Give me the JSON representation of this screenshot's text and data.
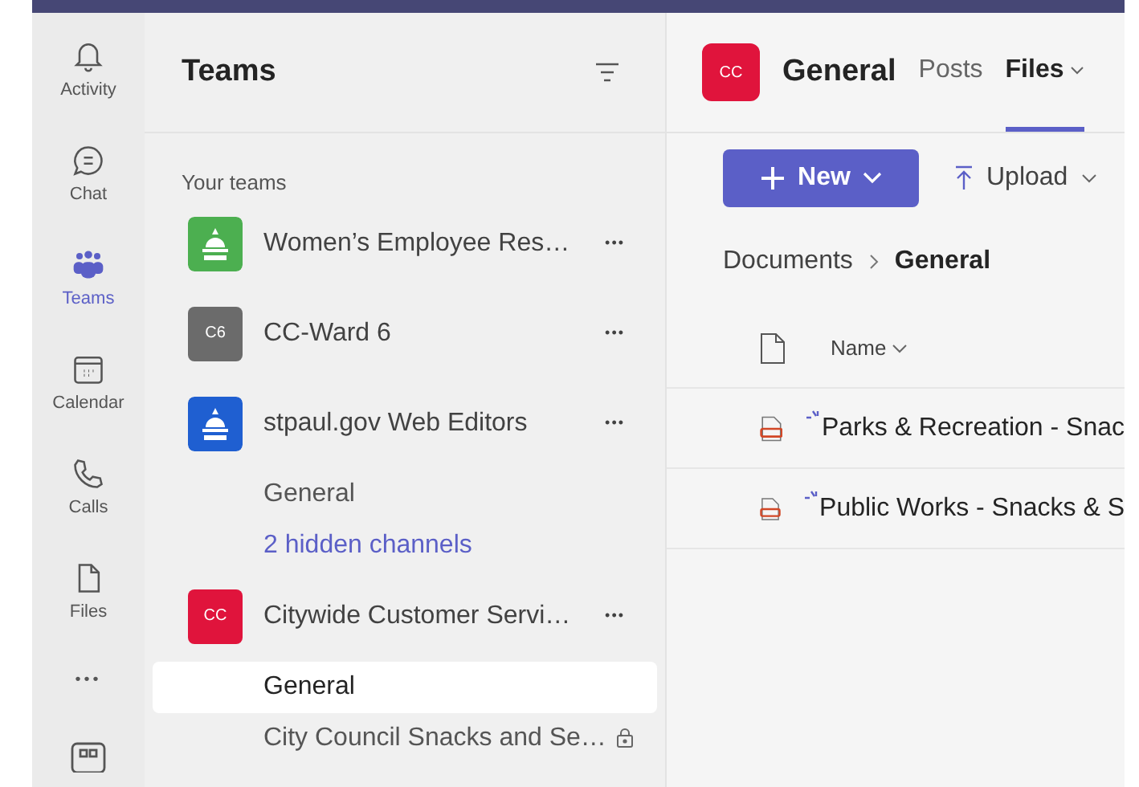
{
  "rail": [
    {
      "label": "Activity",
      "selected": false
    },
    {
      "label": "Chat",
      "selected": false
    },
    {
      "label": "Teams",
      "selected": true
    },
    {
      "label": "Calendar",
      "selected": false
    },
    {
      "label": "Calls",
      "selected": false
    },
    {
      "label": "Files",
      "selected": false
    }
  ],
  "more": "•••",
  "panel": {
    "title": "Teams",
    "section": "Your teams",
    "teams": [
      {
        "name": "Women’s Employee Res…",
        "kind": "emblem",
        "color": "#4caf50",
        "more": "•••"
      },
      {
        "name": "CC-Ward 6",
        "kind": "initials",
        "avatar_text": "C6",
        "color": "#6b6b6b",
        "more": "•••"
      },
      {
        "name": "stpaul.gov Web Editors",
        "kind": "emblem",
        "color": "#1f5fd1",
        "more": "•••",
        "channels": [
          {
            "name": "General",
            "kind": "channel",
            "selected": false,
            "private": false
          },
          {
            "name": "2 hidden channels",
            "kind": "link",
            "selected": false,
            "private": false
          }
        ]
      },
      {
        "name": "Citywide Customer Servi…",
        "kind": "initials",
        "avatar_text": "CC",
        "color": "#e0143c",
        "more": "•••",
        "channels": [
          {
            "name": "General",
            "kind": "channel",
            "selected": true,
            "private": false
          },
          {
            "name": "City Council Snacks and Se…",
            "kind": "channel",
            "selected": false,
            "private": true
          }
        ]
      }
    ]
  },
  "main": {
    "avatar_text": "CC",
    "title": "General",
    "tabs": [
      {
        "label": "Posts",
        "selected": false,
        "dropdown": false
      },
      {
        "label": "Files",
        "selected": true,
        "dropdown": true
      }
    ],
    "new_button": "New",
    "upload_button": "Upload",
    "breadcrumb": [
      "Documents",
      "General"
    ],
    "column": "Name",
    "files": [
      "Parks & Recreation - Snac",
      "Public Works - Snacks & S"
    ]
  }
}
